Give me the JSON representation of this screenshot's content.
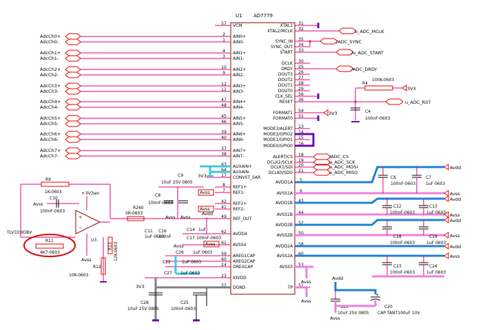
{
  "chip": {
    "ref": "U1",
    "part": "AD7779"
  },
  "left_pins": [
    {
      "n": "57",
      "name": "VCM"
    },
    {
      "n": "2",
      "name": "AIN0+"
    },
    {
      "n": "1",
      "name": "AIN0-"
    },
    {
      "n": "4",
      "name": "AIN1+"
    },
    {
      "n": "3",
      "name": "AIN1-"
    },
    {
      "n": "10",
      "name": "AIN2+"
    },
    {
      "n": "9",
      "name": "AIN2-"
    },
    {
      "n": "12",
      "name": "AIN3+"
    },
    {
      "n": "11",
      "name": "AIN3-"
    },
    {
      "n": "47",
      "name": "AIN4+"
    },
    {
      "n": "48",
      "name": "AIN4-"
    },
    {
      "n": "45",
      "name": "AIN5+"
    },
    {
      "n": "46",
      "name": "AIN5-"
    },
    {
      "n": "39",
      "name": "AIN6+"
    },
    {
      "n": "40",
      "name": "AIN6-"
    },
    {
      "n": "37",
      "name": "AIN7+"
    },
    {
      "n": "38",
      "name": "AIN7-"
    },
    {
      "n": "63",
      "name": "AUXAIN+"
    },
    {
      "n": "64",
      "name": "AUXAIN-"
    },
    {
      "n": "17",
      "name": "CONVST_SAR"
    },
    {
      "n": "8",
      "name": "REF1+"
    },
    {
      "n": "7",
      "name": "REF1-"
    },
    {
      "n": "42",
      "name": "REF2+"
    },
    {
      "n": "41",
      "name": "REF2-"
    },
    {
      "n": "49",
      "name": "REF_OUT"
    },
    {
      "n": "62",
      "name": "AVDD4"
    },
    {
      "n": "61",
      "name": "AVSS4"
    },
    {
      "n": "59",
      "name": "AREG1CAP"
    },
    {
      "n": "60",
      "name": "AREG2CAP"
    },
    {
      "n": "24",
      "name": "DREGCAP"
    },
    {
      "n": "23",
      "name": "IOVDD"
    },
    {
      "n": "22",
      "name": "DGND"
    }
  ],
  "right_pins": [
    {
      "n": "31",
      "name": "XTAL1"
    },
    {
      "n": "32",
      "name": "XTAL2/MCLK"
    },
    {
      "n": "35",
      "name": "SYNC_IN"
    },
    {
      "n": "34",
      "name": "SYNC_OUT"
    },
    {
      "n": "33",
      "name": "START"
    },
    {
      "n": "30",
      "name": "DCLK"
    },
    {
      "n": "25",
      "name": "DRDY"
    },
    {
      "n": "26",
      "name": "DOUT3"
    },
    {
      "n": "27",
      "name": "DOUT2"
    },
    {
      "n": "28",
      "name": "DOUT1"
    },
    {
      "n": "29",
      "name": "DOUT0"
    },
    {
      "n": "56",
      "name": "CLK_SEL"
    },
    {
      "n": "36",
      "name": "RESET"
    },
    {
      "n": "54",
      "name": "FORMAT1"
    },
    {
      "n": "55",
      "name": "FORMAT0"
    },
    {
      "n": "13",
      "name": "MODE3/ALERT"
    },
    {
      "n": "14",
      "name": "MODE2/GPIO2"
    },
    {
      "n": "15",
      "name": "MODE1/GPIO1"
    },
    {
      "n": "16",
      "name": "MODE0/GPIO0"
    },
    {
      "n": "18",
      "name": "ALERT/CS"
    },
    {
      "n": "19",
      "name": "DCLK2/SCLK"
    },
    {
      "n": "20",
      "name": "DCLK1/SDI"
    },
    {
      "n": "21",
      "name": "DCLK0/SDO"
    },
    {
      "n": "5",
      "name": "AVDD1A"
    },
    {
      "n": "6",
      "name": "AVSS1A"
    },
    {
      "n": "43",
      "name": "AVDD1B"
    },
    {
      "n": "44",
      "name": "AVSS1B"
    },
    {
      "n": "52",
      "name": "AVDD2B"
    },
    {
      "n": "50",
      "name": "AVSS2B"
    },
    {
      "n": "58",
      "name": "AVDD2A"
    },
    {
      "n": "60",
      "name": "AVSS2A"
    },
    {
      "n": "53",
      "name": "AVSS3"
    },
    {
      "n": "51",
      "name": "TP"
    }
  ],
  "adc_inputs": [
    "AdcCh0+",
    "AdcCh0-",
    "AdcCh1+",
    "AdcCh1-",
    "AdcCh2+",
    "AdcCh2-",
    "AdcCh3+",
    "AdcCh3-",
    "AdcCh4+",
    "AdcCh4-",
    "AdcCh5+",
    "AdcCh5-",
    "AdcCh6+",
    "AdcCh6-",
    "AdcCh7+",
    "AdcCh7-"
  ],
  "nets_right": {
    "mclk": "u_ADC_MCLK",
    "sync": "/ADC_SYNC",
    "start": "/u_ADC_START",
    "drdy": "/ADC_DRDY",
    "rst": "u_ADC_RST",
    "cs": "/ADC_CS",
    "sck": "u_ADC_SCK",
    "mosi": "u_ADC_MOSI",
    "miso": "u_ADC_MISO",
    "v3": "3V3",
    "avdd": "Avdd",
    "avss": "Avss"
  },
  "parts": {
    "r4": "R4",
    "r4v": "100K-0603",
    "c4": "C4",
    "c4v": "100nF-0603",
    "c6": "C6",
    "c6v": "100nF-0603",
    "c7": "C7",
    "c7v": "1uF 0603",
    "c12": "C12",
    "c12v": "100nF-0603",
    "c13": "C13",
    "c13v": "1uF 0603",
    "c18": "C18",
    "c18v": "100nF-0603",
    "c19": "C19",
    "c19v": "1uF 0603",
    "c23": "C23",
    "c23v": "100nF-0603",
    "c24": "C24",
    "c24v": "1uF 0603",
    "c21": "C21",
    "c21v": "10uF 25V 0805",
    "c20": "C20",
    "c20v": "CAP TANT100uF 10V",
    "r9": "R9",
    "r9v": "1K-0603",
    "c10": "C10",
    "c10v": "100nF-0603",
    "v3an": "+3V3an",
    "opamp": "TLV333IDBV",
    "u3": "U3",
    "r11": "R11",
    "r11v": "4K7-0603",
    "r12": "R12",
    "r12v": "10K-0603",
    "r13": "R13",
    "r13v": "12K-0603",
    "r260": "R260",
    "r260v": "0R-0603",
    "c9": "C9",
    "c9v": "10uF 25V 0805",
    "c8": "C8",
    "c8v": "100nF-0603",
    "c11": "C11",
    "c11v": "1uF 0603",
    "c16": "C16",
    "c16v": "100nF",
    "c14": "C14",
    "c14v": "1uF",
    "c17": "C17",
    "c17v": "100nF-0603",
    "c26": "C26",
    "c26v": "1uF 0603",
    "c22": "C22",
    "c22v": "1uF 0603",
    "c27": "C27",
    "c27v": "1uF 0603",
    "c28": "C28",
    "c28v": "10uF 25V 0805",
    "c25": "C25",
    "c25v": "100nF-0603"
  },
  "colors": {
    "wire": "#e0007a",
    "blue": "#1e7fd6",
    "purple": "#6a0dad",
    "pink": "#ee7fdc",
    "red": "#e00000",
    "grey": "#808080",
    "cyan": "#40c8d8"
  }
}
